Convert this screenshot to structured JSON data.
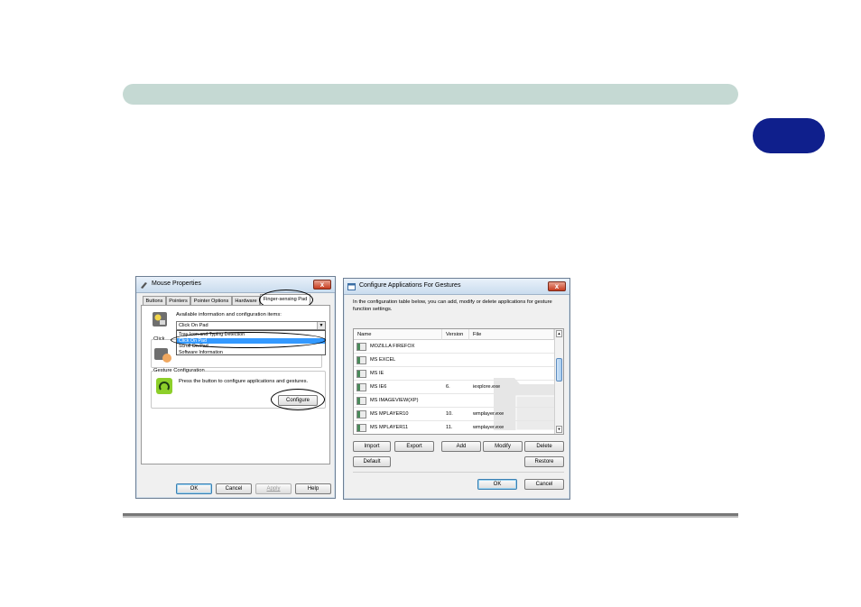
{
  "mouse_properties": {
    "title": "Mouse Properties",
    "close_label": "x",
    "tabs": [
      {
        "label": "Buttons"
      },
      {
        "label": "Pointers"
      },
      {
        "label": "Pointer Options"
      },
      {
        "label": "Hardware"
      },
      {
        "label": "Finger-sensing Pad"
      }
    ],
    "available_label": "Available information and configuration items:",
    "combo_value": "Click On Pad",
    "dropdown_options": [
      "Tray Icon and Typing Detection",
      "Click On Pad",
      "Scroll On Pad",
      "Software Information"
    ],
    "selected_option": "Click On Pad",
    "clickon_group_label": "Click",
    "gesture_group_label": "Gesture Configuration",
    "gesture_text": "Press the button to configure applications and gestures.",
    "configure_label": "Configure",
    "footer_buttons": {
      "ok": "OK",
      "cancel": "Cancel",
      "apply": "Apply",
      "help": "Help"
    }
  },
  "configure_apps": {
    "title": "Configure Applications For Gestures",
    "close_label": "x",
    "description": "In the configuration table below, you can add, modify or delete applications for gesture function settings.",
    "columns": [
      "Name",
      "Version",
      "File"
    ],
    "rows": [
      {
        "name": "MOZILLA FIREFOX",
        "version": "",
        "file": ""
      },
      {
        "name": "MS EXCEL",
        "version": "",
        "file": ""
      },
      {
        "name": "MS IE",
        "version": "",
        "file": ""
      },
      {
        "name": "MS IE6",
        "version": "6.",
        "file": "iexplore.exe"
      },
      {
        "name": "MS IMAGEVIEW(XP)",
        "version": "",
        "file": ""
      },
      {
        "name": "MS MPLAYER10",
        "version": "10.",
        "file": "wmplayer.exe"
      },
      {
        "name": "MS MPLAYER11",
        "version": "11.",
        "file": "wmplayer.exe"
      }
    ],
    "buttons": {
      "import": "Import",
      "export": "Export",
      "add": "Add",
      "modify": "Modify",
      "delete": "Delete",
      "default": "Default",
      "restore": "Restore",
      "ok": "OK",
      "cancel": "Cancel"
    }
  }
}
